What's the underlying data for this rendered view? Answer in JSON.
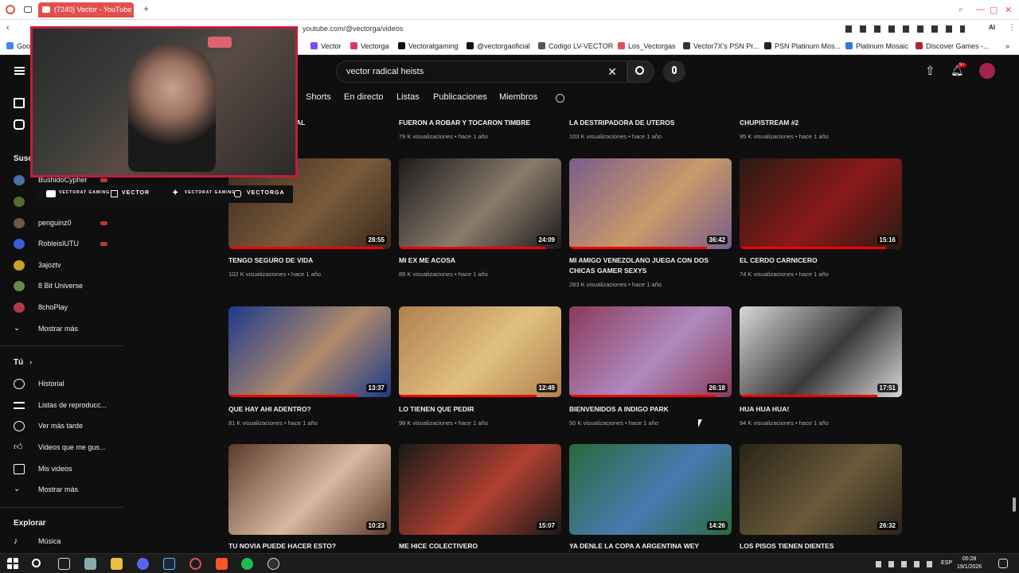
{
  "browser": {
    "tab_title": "(7240) Vector - YouTube",
    "address_text": "youtube.com/@vectorga/videos",
    "bookmarks": [
      "Vector",
      "Vectorga",
      "Vectoratgaming",
      "@vectorgaoficial",
      "Codigo LV-VECTOR",
      "Los_Vectorgas",
      "Vector7X's PSN Pr...",
      "PSN Platinum Mos...",
      "Platinum Mosaic",
      "Discover Games -..."
    ],
    "bookmark_first": "Goog"
  },
  "youtube": {
    "search_value": "vector radical heists",
    "notifications_badge": "9+",
    "channel_tabs": [
      "Shorts",
      "En directo",
      "Listas",
      "Publicaciones",
      "Miembros"
    ]
  },
  "sidebar": {
    "subscriptions_header": "Susc",
    "subscriptions": [
      {
        "label": "BushidoCypher",
        "color": "#4a6fa5",
        "live": true
      },
      {
        "label": "",
        "color": "#556b2f",
        "live": false
      },
      {
        "label": "penguinz0",
        "color": "#6b5a45",
        "live": true
      },
      {
        "label": "RobleisIUTU",
        "color": "#3b5bdb",
        "live": true
      },
      {
        "label": "3ajoztv",
        "color": "#c9a227",
        "live": false
      },
      {
        "label": "8 Bit Universe",
        "color": "#5e8c4a",
        "live": false
      },
      {
        "label": "8choPlay",
        "color": "#b03a48",
        "live": false
      }
    ],
    "show_more_1": "Mostrar más",
    "you_header": "Tú",
    "you_items": [
      "Historial",
      "Listas de reproducc...",
      "Ver más tarde",
      "Videos que me gus...",
      "Mis videos"
    ],
    "show_more_2": "Mostrar más",
    "explore_header": "Explorar",
    "explore_items": [
      "Música"
    ]
  },
  "cam_strip": [
    "VECTORAT GAMING",
    "VECTOR",
    "VECTORAT GAMING",
    "VECTORGA"
  ],
  "videos_row0": [
    {
      "title": "…CIAL",
      "meta": ""
    },
    {
      "title": "FUERON A ROBAR Y TOCARON TIMBRE",
      "meta": "79 K visualizaciones • hace 1 año"
    },
    {
      "title": "LA DESTRIPADORA DE UTEROS",
      "meta": "103 K visualizaciones • hace 1 año"
    },
    {
      "title": "CHUPISTREAM #2",
      "meta": "95 K visualizaciones • hace 1 año"
    }
  ],
  "videos_row1": [
    {
      "title": "TENGO SEGURO DE VIDA",
      "meta": "102 K visualizaciones • hace 1 año",
      "duration": "28:55",
      "c1": "#3a2a1c",
      "c2": "#7a5a3a",
      "progress": 0.95
    },
    {
      "title": "MI EX ME ACOSA",
      "meta": "89 K visualizaciones • hace 1 año",
      "duration": "24:09",
      "c1": "#1b1b1b",
      "c2": "#8a7b6c",
      "progress": 0.9
    },
    {
      "title": "MI AMIGO VENEZOLANO JUEGA CON DOS CHICAS GAMER SEXYS",
      "meta": "283 K visualizaciones • hace 1 año",
      "duration": "36:42",
      "c1": "#7a5c8a",
      "c2": "#c99a6a",
      "progress": 0.85
    },
    {
      "title": "EL CERDO CARNICERO",
      "meta": "74 K visualizaciones • hace 1 año",
      "duration": "15:16",
      "c1": "#2a1a12",
      "c2": "#8a1a1a",
      "progress": 0.9
    }
  ],
  "videos_row2": [
    {
      "title": "QUE HAY AHI ADENTRO?",
      "meta": "81 K visualizaciones • hace 1 año",
      "duration": "13:37",
      "c1": "#1d3a8a",
      "c2": "#b08a6a",
      "progress": 0.8
    },
    {
      "title": "LO TIENEN QUE PEDIR",
      "meta": "98 K visualizaciones • hace 1 año",
      "duration": "12:49",
      "c1": "#b08050",
      "c2": "#e0c080",
      "progress": 0.85
    },
    {
      "title": "BIENVENIDOS A INDIGO PARK",
      "meta": "50 K visualizaciones • hace 1 año",
      "duration": "26:18",
      "c1": "#8a3a5a",
      "c2": "#b08ac0",
      "progress": 0.9
    },
    {
      "title": "HUA HUA HUA!",
      "meta": "94 K visualizaciones • hace 1 año",
      "duration": "17:51",
      "c1": "#d8d8d8",
      "c2": "#3a3a3a",
      "progress": 0.85
    }
  ],
  "videos_row3": [
    {
      "title": "TU NOVIA PUEDE HACER ESTO?",
      "duration": "10:23",
      "c1": "#5a3a2a",
      "c2": "#d8b8a0",
      "progress": 0.0
    },
    {
      "title": "ME HICE COLECTIVERO",
      "duration": "15:07",
      "c1": "#1a1a1a",
      "c2": "#b04030",
      "progress": 0.0
    },
    {
      "title": "YA DENLE LA COPA A ARGENTINA WEY",
      "duration": "14:26",
      "c1": "#2a6a3a",
      "c2": "#4a7ab0",
      "progress": 0.0
    },
    {
      "title": "LOS PISOS TIENEN DIENTES",
      "duration": "26:32",
      "c1": "#2a2418",
      "c2": "#6a5a3a",
      "progress": 0.0
    }
  ],
  "taskbar": {
    "lang": "ESP",
    "time": "05:28",
    "date": "19/1/2026"
  }
}
